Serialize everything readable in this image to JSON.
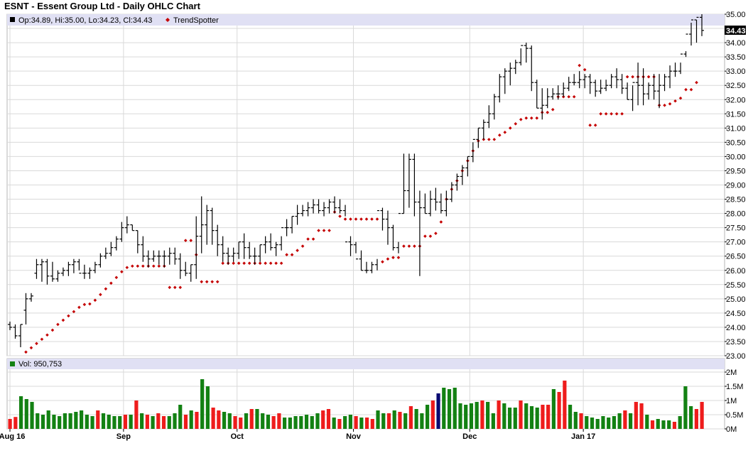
{
  "title": "ESNT - Essent Group Ltd - Daily OHLC Chart",
  "colors": {
    "up": "#138113",
    "down": "#ee1c1c",
    "current": "#0a0a72",
    "trend": "#c40000",
    "panel_header": "#e0e0f4",
    "grid": "#d9d9d9"
  },
  "price_legend": {
    "ohlc": "Op:34.89, Hi:35.00, Lo:34.23, Cl:34.43",
    "trend_label": "TrendSpotter",
    "last_price": "34.43"
  },
  "volume_legend": {
    "label": "Vol: 950,753"
  },
  "chart_data": [
    {
      "type": "ohlc",
      "ylim": [
        23.0,
        35.0
      ],
      "y_ticks": [
        "35.00",
        "34.50",
        "34.00",
        "33.50",
        "33.00",
        "32.50",
        "32.00",
        "31.50",
        "31.00",
        "30.50",
        "30.00",
        "29.50",
        "29.00",
        "28.50",
        "28.00",
        "27.50",
        "27.00",
        "26.50",
        "26.00",
        "25.50",
        "25.00",
        "24.50",
        "24.00",
        "23.50",
        "23.00"
      ],
      "x_ticks": [
        "Aug 16",
        "Sep",
        "Oct",
        "Nov",
        "Dec",
        "Jan 17"
      ],
      "grid": true,
      "series": [
        {
          "name": "OHLC",
          "open": [
            24.1,
            24.0,
            23.7,
            24.6,
            25.0,
            25.9,
            26.2,
            26.3,
            25.8,
            25.7,
            25.9,
            26.0,
            26.2,
            26.3,
            25.9,
            25.9,
            26.0,
            26.2,
            26.5,
            26.6,
            26.8,
            27.1,
            27.5,
            27.6,
            27.4,
            26.9,
            26.5,
            26.4,
            26.5,
            26.5,
            26.5,
            26.6,
            26.4,
            26.0,
            25.9,
            26.2,
            27.2,
            27.6,
            28.1,
            27.4,
            26.9,
            26.6,
            26.5,
            26.6,
            27.0,
            26.8,
            26.5,
            26.5,
            26.9,
            27.0,
            26.8,
            26.9,
            27.5,
            27.5,
            27.9,
            28.0,
            28.1,
            28.2,
            28.3,
            28.1,
            28.2,
            28.4,
            28.2,
            28.1,
            27.0,
            26.9,
            26.4,
            26.0,
            26.0,
            26.2,
            28.1,
            27.8,
            27.5,
            26.8,
            28.0,
            28.8,
            29.9,
            28.4,
            28.2,
            28.0,
            28.5,
            28.4,
            28.1,
            28.5,
            29.0,
            29.3,
            29.6,
            30.0,
            30.6,
            31.0,
            31.2,
            31.5,
            32.1,
            32.8,
            33.0,
            33.1,
            33.3,
            33.9,
            33.8,
            32.6,
            31.7,
            31.8,
            32.1,
            32.2,
            32.2,
            32.4,
            32.6,
            32.6,
            32.7,
            32.8,
            32.6,
            32.3,
            32.4,
            32.5,
            32.8,
            32.7,
            32.4,
            32.0,
            32.6,
            32.5,
            32.2,
            32.5,
            32.3,
            32.5,
            32.8,
            33.0,
            33.0,
            33.6,
            34.3,
            34.8,
            34.89
          ],
          "high": [
            24.2,
            24.1,
            24.1,
            25.2,
            25.2,
            26.4,
            26.4,
            26.4,
            26.3,
            26.0,
            26.1,
            26.3,
            26.4,
            26.4,
            26.2,
            26.1,
            26.3,
            26.6,
            26.8,
            27.0,
            27.2,
            27.7,
            27.9,
            27.6,
            27.4,
            27.2,
            26.7,
            26.7,
            26.7,
            26.7,
            26.8,
            26.8,
            26.6,
            26.3,
            26.2,
            27.9,
            28.6,
            28.3,
            28.2,
            27.6,
            27.2,
            26.8,
            26.8,
            27.0,
            27.3,
            27.0,
            26.8,
            26.9,
            27.2,
            27.3,
            27.0,
            27.2,
            27.8,
            27.9,
            28.3,
            28.3,
            28.4,
            28.5,
            28.5,
            28.4,
            28.5,
            28.6,
            28.5,
            28.3,
            27.2,
            27.0,
            26.7,
            26.3,
            26.3,
            26.4,
            28.2,
            28.1,
            27.6,
            27.0,
            30.1,
            30.1,
            30.1,
            28.8,
            28.7,
            28.8,
            28.9,
            28.7,
            28.8,
            29.1,
            29.4,
            29.7,
            30.0,
            30.5,
            31.0,
            31.3,
            31.8,
            32.2,
            32.9,
            33.1,
            33.3,
            33.4,
            33.8,
            34.0,
            33.9,
            32.7,
            32.4,
            32.4,
            32.4,
            32.5,
            32.6,
            32.8,
            32.9,
            33.0,
            32.9,
            32.9,
            32.7,
            32.7,
            32.7,
            32.9,
            33.1,
            32.9,
            32.6,
            32.5,
            33.3,
            33.1,
            32.6,
            32.9,
            32.9,
            32.9,
            33.2,
            33.3,
            33.3,
            33.7,
            34.7,
            34.8,
            35.0
          ],
          "low": [
            23.9,
            23.6,
            23.3,
            24.1,
            24.9,
            25.7,
            25.6,
            25.5,
            25.6,
            25.6,
            25.8,
            25.8,
            25.9,
            26.0,
            25.7,
            25.7,
            25.9,
            26.1,
            26.4,
            26.5,
            26.7,
            27.0,
            27.3,
            27.4,
            26.6,
            26.3,
            26.1,
            26.3,
            26.2,
            26.1,
            26.2,
            26.2,
            25.7,
            25.8,
            25.6,
            25.7,
            26.6,
            26.9,
            26.9,
            26.5,
            26.3,
            26.2,
            26.3,
            26.4,
            26.4,
            26.4,
            26.2,
            26.3,
            26.6,
            26.7,
            26.5,
            26.7,
            27.2,
            27.3,
            27.6,
            27.9,
            27.9,
            28.0,
            28.0,
            27.9,
            28.0,
            28.0,
            28.0,
            27.9,
            26.5,
            26.6,
            26.0,
            25.9,
            25.9,
            26.0,
            27.4,
            26.9,
            26.7,
            26.6,
            28.0,
            28.2,
            27.9,
            25.8,
            28.0,
            27.9,
            28.1,
            28.0,
            27.9,
            28.4,
            28.8,
            29.0,
            29.3,
            29.8,
            30.3,
            30.6,
            31.0,
            31.3,
            31.9,
            32.2,
            32.5,
            32.9,
            33.2,
            33.3,
            32.3,
            31.7,
            31.3,
            31.7,
            32.0,
            32.0,
            32.1,
            32.3,
            32.5,
            32.4,
            32.4,
            32.2,
            32.1,
            32.2,
            32.3,
            32.4,
            32.4,
            32.2,
            32.0,
            31.6,
            31.8,
            31.8,
            32.0,
            32.0,
            31.7,
            32.3,
            32.4,
            32.8,
            32.9,
            33.5,
            33.9,
            34.0,
            34.23
          ],
          "close": [
            24.0,
            23.7,
            24.1,
            25.0,
            25.1,
            26.2,
            26.3,
            25.8,
            25.7,
            25.9,
            26.0,
            26.2,
            26.3,
            25.9,
            25.9,
            26.0,
            26.2,
            26.5,
            26.6,
            26.8,
            27.1,
            27.5,
            27.6,
            27.4,
            26.9,
            26.5,
            26.4,
            26.5,
            26.5,
            26.5,
            26.6,
            26.4,
            26.0,
            25.9,
            26.2,
            27.2,
            27.6,
            28.1,
            27.4,
            26.9,
            26.6,
            26.5,
            26.6,
            27.0,
            26.8,
            26.5,
            26.5,
            26.9,
            27.0,
            26.8,
            26.9,
            27.5,
            27.5,
            27.9,
            28.0,
            28.1,
            28.2,
            28.3,
            28.1,
            28.2,
            28.4,
            28.2,
            28.1,
            27.0,
            26.9,
            26.4,
            26.0,
            26.0,
            26.2,
            28.1,
            27.8,
            27.5,
            26.8,
            28.0,
            28.8,
            29.9,
            28.4,
            28.2,
            28.0,
            28.5,
            28.4,
            28.1,
            28.5,
            29.0,
            29.3,
            29.6,
            30.0,
            30.6,
            31.0,
            31.2,
            31.5,
            32.1,
            32.8,
            33.0,
            33.1,
            33.3,
            33.9,
            33.8,
            32.6,
            31.7,
            31.8,
            32.1,
            32.2,
            32.2,
            32.4,
            32.6,
            32.6,
            32.7,
            32.8,
            32.6,
            32.3,
            32.4,
            32.5,
            32.8,
            32.7,
            32.4,
            32.0,
            32.6,
            32.5,
            32.2,
            32.5,
            32.3,
            32.5,
            32.8,
            33.0,
            33.0,
            33.6,
            34.3,
            34.8,
            34.89,
            34.43
          ]
        },
        {
          "name": "TrendSpotter",
          "values": [
            null,
            null,
            null,
            23.13,
            23.28,
            23.43,
            23.58,
            23.73,
            23.9,
            24.1,
            24.25,
            24.4,
            24.55,
            24.7,
            24.8,
            24.82,
            24.95,
            25.15,
            25.35,
            25.55,
            25.75,
            25.95,
            26.1,
            26.15,
            26.15,
            26.15,
            26.15,
            26.15,
            26.15,
            26.15,
            25.4,
            25.4,
            25.4,
            27.05,
            27.05,
            26.55,
            25.6,
            25.6,
            25.6,
            25.6,
            26.25,
            26.25,
            26.25,
            26.25,
            26.25,
            26.25,
            26.25,
            26.25,
            26.25,
            26.25,
            26.25,
            26.25,
            26.55,
            26.55,
            26.7,
            26.85,
            27.1,
            27.1,
            27.4,
            27.4,
            27.4,
            28.05,
            27.9,
            27.8,
            27.8,
            27.8,
            27.8,
            27.8,
            27.8,
            27.8,
            26.3,
            26.4,
            26.45,
            26.45,
            26.85,
            26.85,
            26.85,
            26.85,
            27.2,
            27.2,
            27.3,
            27.7,
            28.5,
            28.85,
            29.15,
            29.5,
            29.85,
            30.2,
            30.55,
            30.6,
            30.6,
            30.6,
            30.75,
            30.85,
            31.0,
            31.15,
            31.3,
            31.35,
            31.35,
            31.35,
            31.55,
            31.55,
            31.65,
            32.1,
            32.1,
            32.1,
            32.1,
            33.2,
            33.05,
            31.1,
            31.1,
            31.5,
            31.5,
            31.5,
            31.5,
            31.5,
            32.8,
            32.8,
            32.8,
            32.8,
            32.8,
            32.8,
            31.8,
            31.8,
            31.85,
            31.95,
            32.05,
            32.35,
            32.35,
            32.6,
            null
          ]
        }
      ]
    },
    {
      "type": "bar",
      "ylim": [
        0,
        2000000
      ],
      "y_ticks": [
        "2M",
        "1.5M",
        "1M",
        "0.5M",
        "0M"
      ],
      "x_ticks": [
        "Aug 16",
        "Sep",
        "Oct",
        "Nov",
        "Dec",
        "Jan 17"
      ],
      "series": [
        {
          "name": "Vol",
          "values": [
            350000,
            420000,
            1150000,
            1050000,
            950000,
            550000,
            500000,
            650000,
            500000,
            450000,
            550000,
            550000,
            600000,
            650000,
            500000,
            450000,
            650000,
            550000,
            500000,
            450000,
            450000,
            500000,
            500000,
            1000000,
            550000,
            500000,
            450000,
            550000,
            450000,
            450000,
            550000,
            850000,
            500000,
            650000,
            600000,
            1750000,
            1500000,
            750000,
            650000,
            600000,
            550000,
            450000,
            400000,
            550000,
            700000,
            700000,
            550000,
            500000,
            450000,
            550000,
            400000,
            400000,
            450000,
            450000,
            500000,
            450000,
            550000,
            650000,
            700000,
            400000,
            350000,
            450000,
            500000,
            450000,
            400000,
            400000,
            350000,
            650000,
            550000,
            550000,
            650000,
            600000,
            550000,
            800000,
            700000,
            550000,
            850000,
            1000000,
            1250000,
            1450000,
            1400000,
            1450000,
            900000,
            850000,
            900000,
            950000,
            1000000,
            950000,
            550000,
            1000000,
            900000,
            750000,
            750000,
            1000000,
            900000,
            800000,
            750000,
            850000,
            850000,
            1400000,
            1300000,
            1700000,
            850000,
            600000,
            550000,
            450000,
            400000,
            350000,
            450000,
            400000,
            450000,
            550000,
            650000,
            550000,
            950000,
            900000,
            500000,
            300000,
            350000,
            300000,
            300000,
            250000,
            450000,
            1500000,
            800000,
            700000,
            950000
          ]
        }
      ],
      "bar_status": [
        "down",
        "down",
        "up",
        "up",
        "up",
        "up",
        "up",
        "up",
        "up",
        "up",
        "up",
        "up",
        "up",
        "up",
        "up",
        "up",
        "down",
        "up",
        "up",
        "up",
        "up",
        "down",
        "up",
        "down",
        "up",
        "down",
        "up",
        "down",
        "down",
        "up",
        "up",
        "up",
        "down",
        "up",
        "down",
        "up",
        "up",
        "down",
        "down",
        "up",
        "up",
        "down",
        "down",
        "up",
        "down",
        "up",
        "up",
        "up",
        "down",
        "down",
        "up",
        "up",
        "up",
        "up",
        "up",
        "up",
        "up",
        "down",
        "down",
        "up",
        "down",
        "up",
        "up",
        "down",
        "up",
        "down",
        "down",
        "up",
        "up",
        "down",
        "up",
        "down",
        "up",
        "down",
        "up",
        "up",
        "up",
        "down",
        "current",
        "up",
        "up",
        "up",
        "up",
        "up",
        "up",
        "up",
        "down",
        "up",
        "up",
        "down",
        "up",
        "up",
        "up",
        "down",
        "up",
        "up",
        "up",
        "down",
        "down",
        "up",
        "down",
        "down",
        "up",
        "up",
        "down",
        "up",
        "up",
        "up",
        "up",
        "up",
        "up",
        "up",
        "down",
        "up",
        "down",
        "down",
        "up",
        "down",
        "up",
        "up",
        "up",
        "down",
        "up",
        "up",
        "up",
        "down",
        "down",
        "down",
        "up"
      ]
    }
  ]
}
